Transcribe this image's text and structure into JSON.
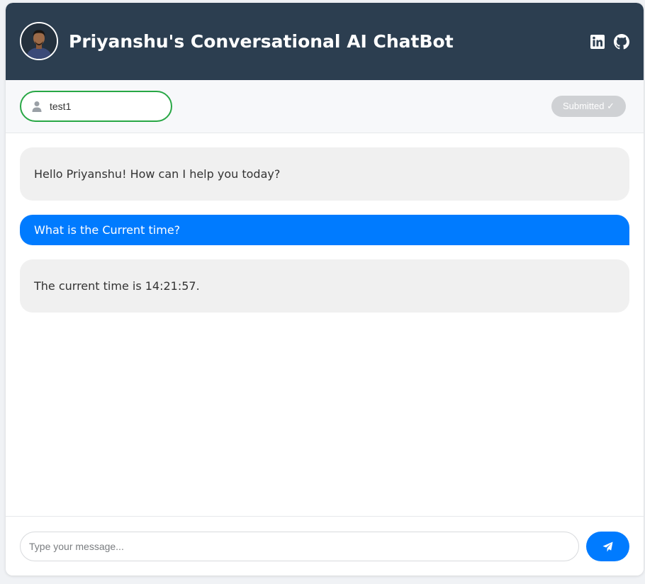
{
  "header": {
    "title": "Priyanshu's Conversational AI ChatBot",
    "avatar_icon": "profile-photo",
    "links": [
      {
        "icon": "linkedin-icon"
      },
      {
        "icon": "github-icon"
      }
    ],
    "background": "#2c3e50"
  },
  "user_bar": {
    "username_value": "test1",
    "user_icon": "user-icon",
    "submit_label": "Submitted ✓",
    "input_border_color": "#28a745"
  },
  "messages": [
    {
      "role": "bot",
      "text": "Hello Priyanshu! How can I help you today?"
    },
    {
      "role": "user",
      "text": "What is the Current time?"
    },
    {
      "role": "bot",
      "text": "The current time is 14:21:57."
    }
  ],
  "composer": {
    "placeholder": "Type your message...",
    "send_icon": "paper-plane-icon",
    "accent": "#007bff"
  }
}
